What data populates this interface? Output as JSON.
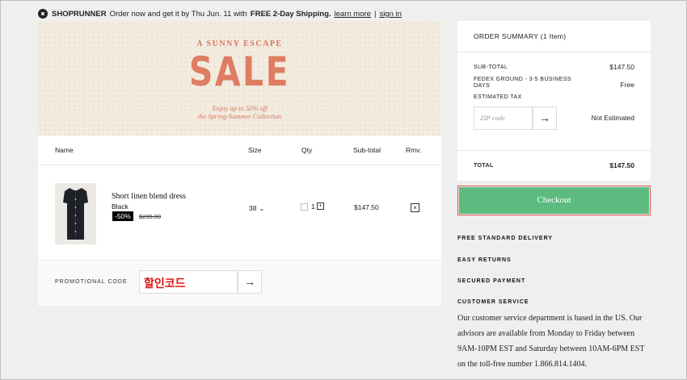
{
  "shoprunner": {
    "brand": "SHOPRUNNER",
    "message_prefix": "Order now and get it by Thu Jun. 11 with",
    "shipping": "FREE 2-Day Shipping.",
    "learn_more": "learn more",
    "separator": "|",
    "sign_in": "sign in"
  },
  "banner": {
    "headline": "A SUNNY ESCAPE",
    "title": "SALE",
    "subline1": "Enjoy up to 50% off",
    "subline2": "the Spring-Summer Collection"
  },
  "cart": {
    "headers": {
      "name": "Name",
      "size": "Size",
      "qty": "Qty",
      "subtotal": "Sub-total",
      "remove": "Rmv."
    },
    "item": {
      "name": "Short linen blend dress",
      "color": "Black",
      "discount": "-50%",
      "old_price": "$295.00",
      "size": "38",
      "qty": "1",
      "subtotal": "$147.50"
    },
    "promo": {
      "label": "PROMOTIONAL CODE",
      "value": "할인코드"
    }
  },
  "summary": {
    "title": "ORDER SUMMARY (1 Item)",
    "subtotal_label": "SUB-TOTAL",
    "subtotal_value": "$147.50",
    "shipping_label": "FEDEX GROUND - 3-5 BUSINESS DAYS",
    "shipping_value": "Free",
    "tax_label": "ESTIMATED TAX",
    "zip_placeholder": "ZIP code",
    "tax_value": "Not Estimated",
    "total_label": "TOTAL",
    "total_value": "$147.50",
    "checkout": "Checkout"
  },
  "info": {
    "delivery": "FREE STANDARD DELIVERY",
    "returns": "EASY RETURNS",
    "payment": "SECURED PAYMENT",
    "service_title": "CUSTOMER SERVICE",
    "service_text": "Our customer service department is based in the US. Our advisors are available from Monday to Friday between 9AM-10PM EST and Saturday between 10AM-6PM EST on the toll-free number 1.866.814.1404."
  },
  "colors": {
    "accent": "#df7d63",
    "checkout": "#5dbb80",
    "promo_text": "#e01010"
  }
}
